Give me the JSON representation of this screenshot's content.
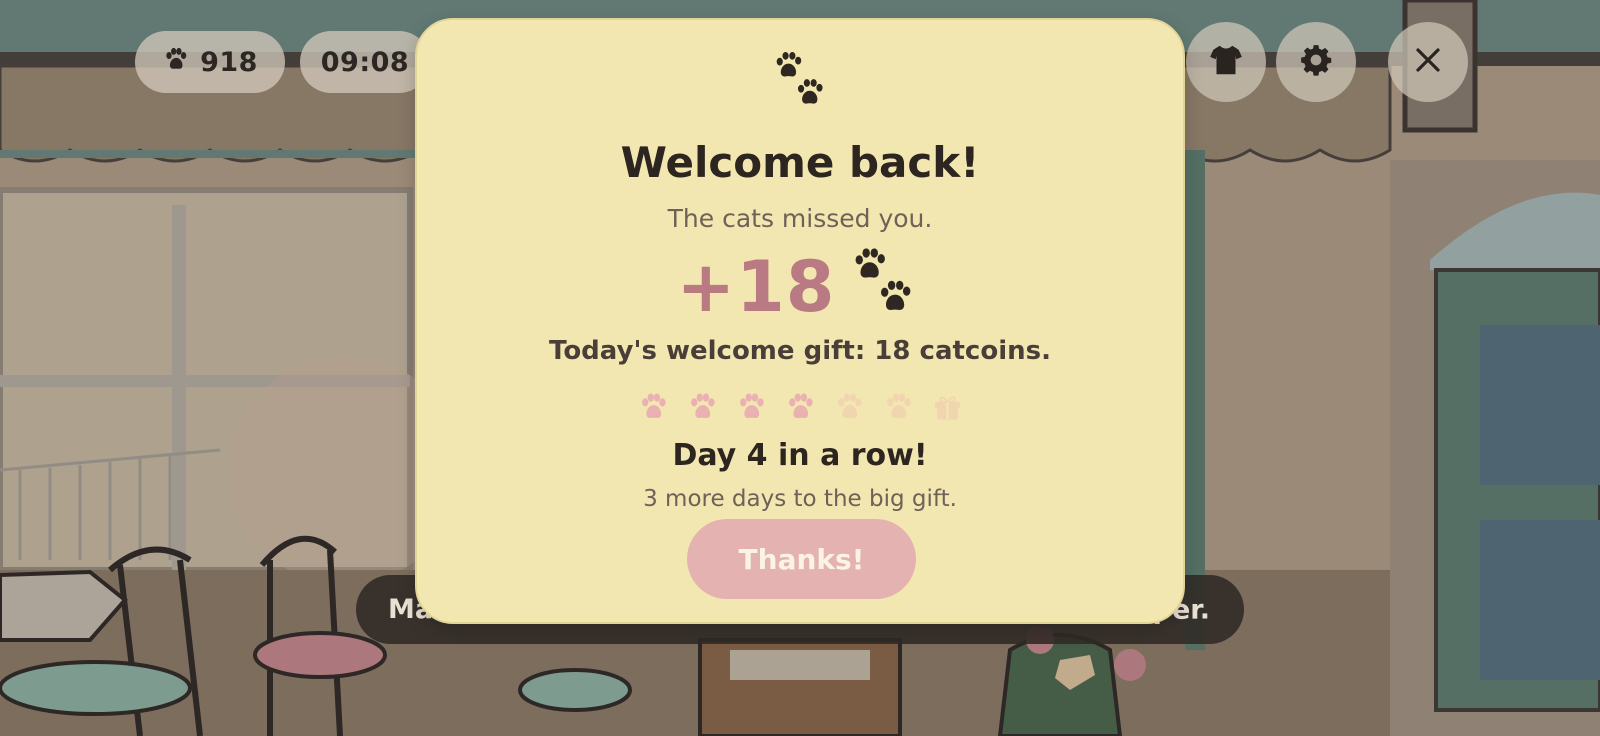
{
  "hud": {
    "coins": "918",
    "time": "09:08",
    "icons": [
      "paw-icon",
      "shirt-icon",
      "gear-icon",
      "close-icon"
    ]
  },
  "hint": {
    "start": "Ma",
    "end": "per."
  },
  "dialog": {
    "title": "Welcome back!",
    "subtitle": "The cats missed you.",
    "reward_amount": "+18",
    "gift_text": "Today's welcome gift: 18 catcoins.",
    "streak_title": "Day 4 in a row!",
    "streak_subtitle": "3 more days to the big gift.",
    "button_label": "Thanks!",
    "streak": {
      "current_day": 4,
      "total_days": 7,
      "final_reward_icon": "gift-icon"
    }
  },
  "colors": {
    "dialog_bg": "#f3e7b1",
    "reward_text": "#b97a83",
    "button_bg": "#e4b2b0",
    "paw_filled": "#ebb0b2",
    "paw_empty": "#f1d4b0",
    "hud_pill": "#d0c7b8"
  }
}
